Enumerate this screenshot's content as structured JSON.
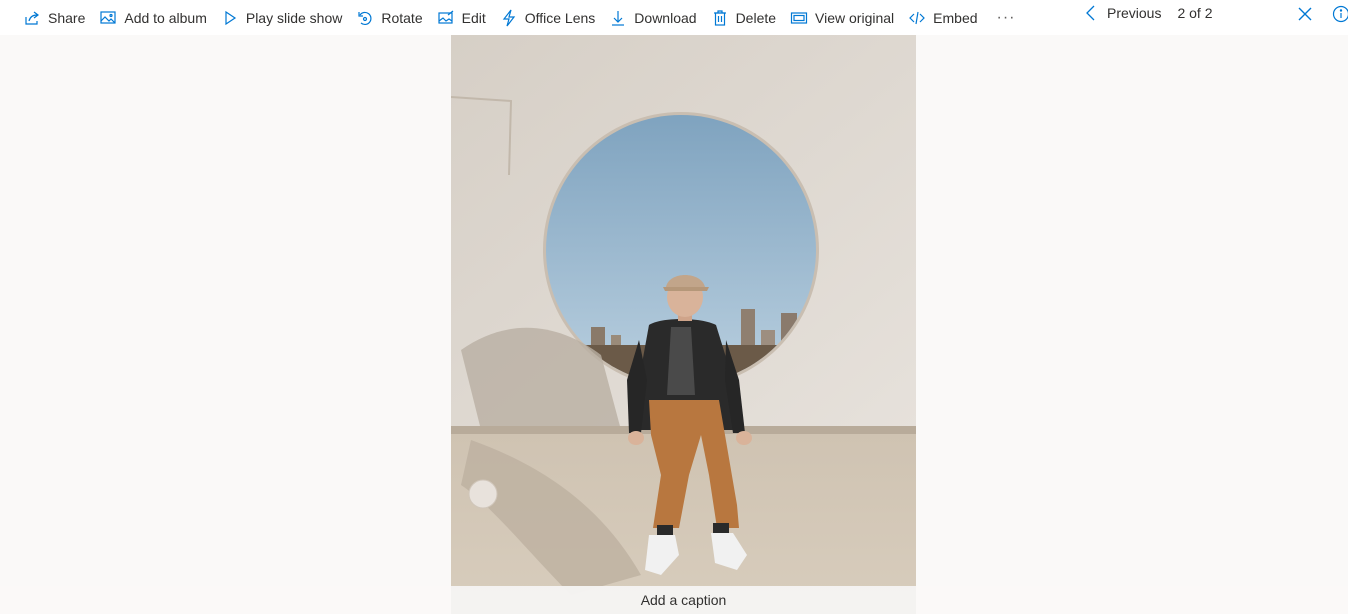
{
  "toolbar": {
    "commands": [
      {
        "label": "Share",
        "icon": "share-icon"
      },
      {
        "label": "Add to album",
        "icon": "image-add-icon"
      },
      {
        "label": "Play slide show",
        "icon": "play-icon"
      },
      {
        "label": "Rotate",
        "icon": "rotate-icon"
      },
      {
        "label": "Edit",
        "icon": "edit-photo-icon"
      },
      {
        "label": "Office Lens",
        "icon": "lightning-icon"
      },
      {
        "label": "Download",
        "icon": "download-icon"
      },
      {
        "label": "Delete",
        "icon": "trash-icon"
      },
      {
        "label": "View original",
        "icon": "view-original-icon"
      },
      {
        "label": "Embed",
        "icon": "embed-icon"
      }
    ],
    "more": "···"
  },
  "nav": {
    "previous_label": "Previous",
    "counter": "2 of 2"
  },
  "photo": {
    "subject": "person sitting on concrete ledge in front of circular window"
  },
  "caption": {
    "placeholder": "Add a caption"
  },
  "colors": {
    "accent": "#0078d4",
    "background": "#faf9f8",
    "toolbar": "#ffffff",
    "text": "#323130"
  }
}
